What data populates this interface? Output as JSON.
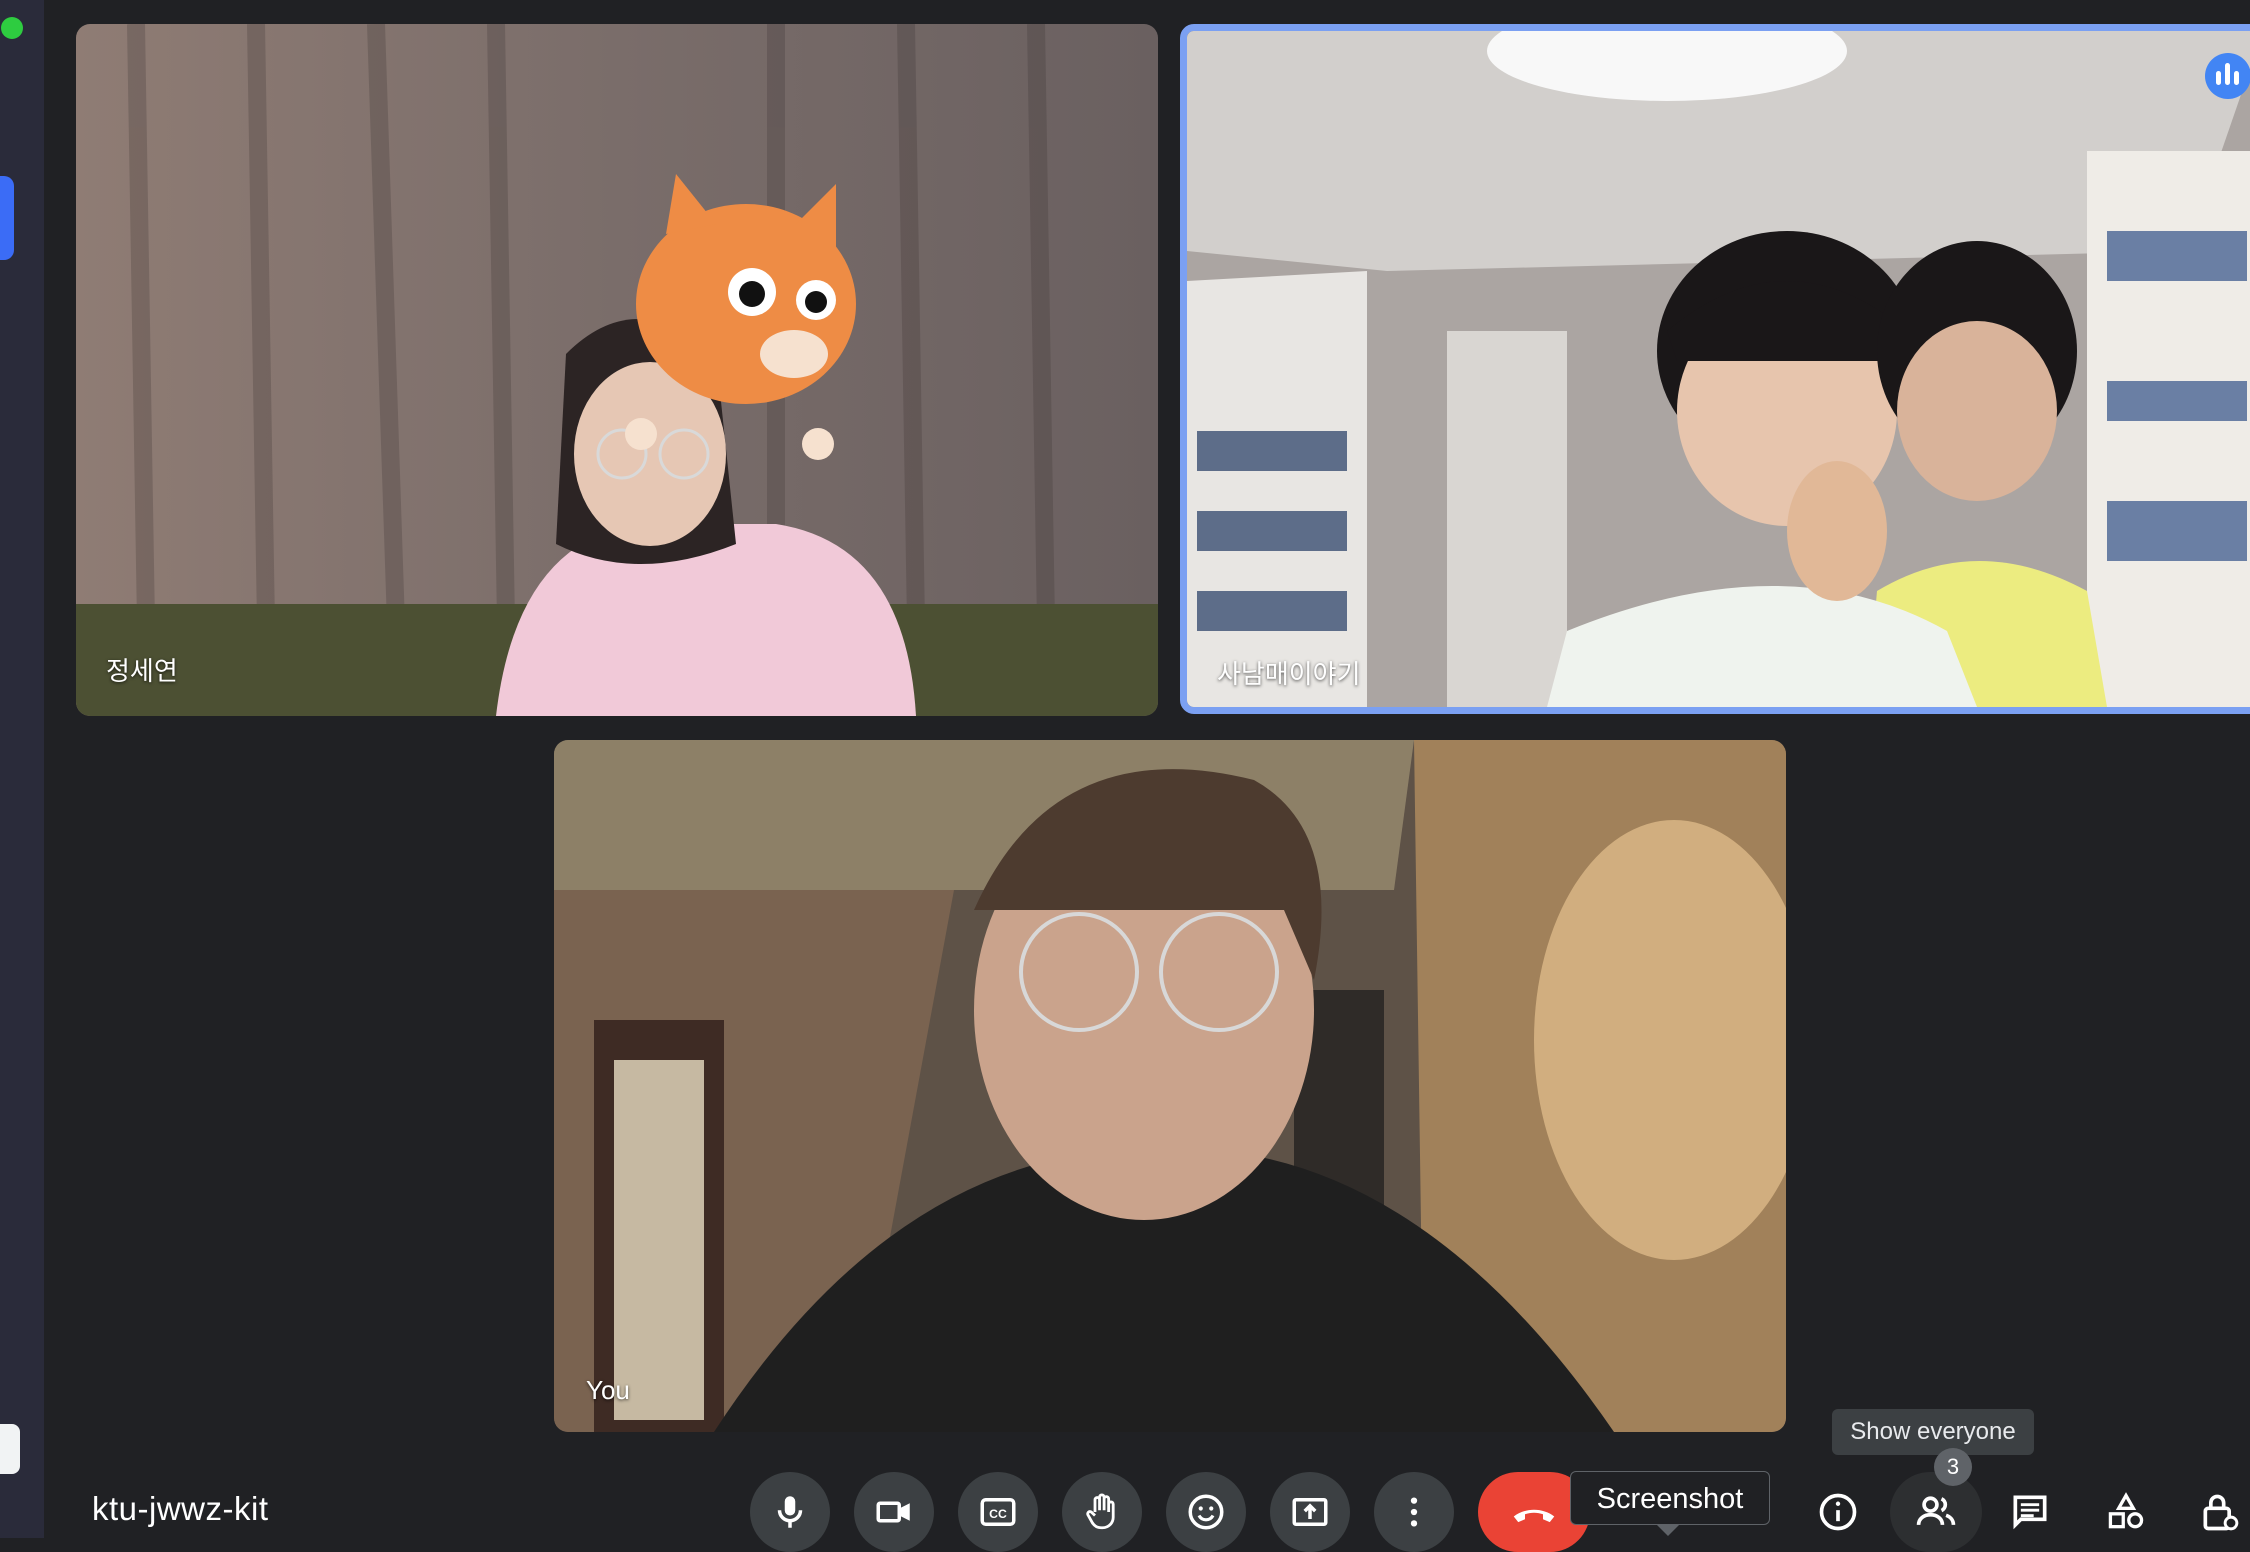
{
  "meeting": {
    "code": "ktu-jwwz-kit"
  },
  "participants": [
    {
      "name": "정세연",
      "effect": "cat-face-filter"
    },
    {
      "name": "사남매이야기",
      "speaking": true
    },
    {
      "name": "You"
    }
  ],
  "controls": [
    {
      "icon": "microphone-icon"
    },
    {
      "icon": "camera-icon"
    },
    {
      "icon": "captions-icon"
    },
    {
      "icon": "raise-hand-icon"
    },
    {
      "icon": "emoji-icon"
    },
    {
      "icon": "present-screen-icon"
    },
    {
      "icon": "more-options-icon"
    },
    {
      "icon": "end-call-icon"
    }
  ],
  "right_controls": [
    {
      "icon": "info-icon"
    },
    {
      "icon": "people-icon",
      "badge": "3"
    },
    {
      "icon": "chat-icon"
    },
    {
      "icon": "activities-icon"
    },
    {
      "icon": "host-controls-icon"
    }
  ],
  "tooltips": {
    "screenshot": "Screenshot",
    "show_everyone": "Show everyone"
  },
  "colors": {
    "background": "#202124",
    "active_speaker_border": "#7ba0f2",
    "end_call": "#ea4335",
    "control_button": "#3c4043"
  }
}
